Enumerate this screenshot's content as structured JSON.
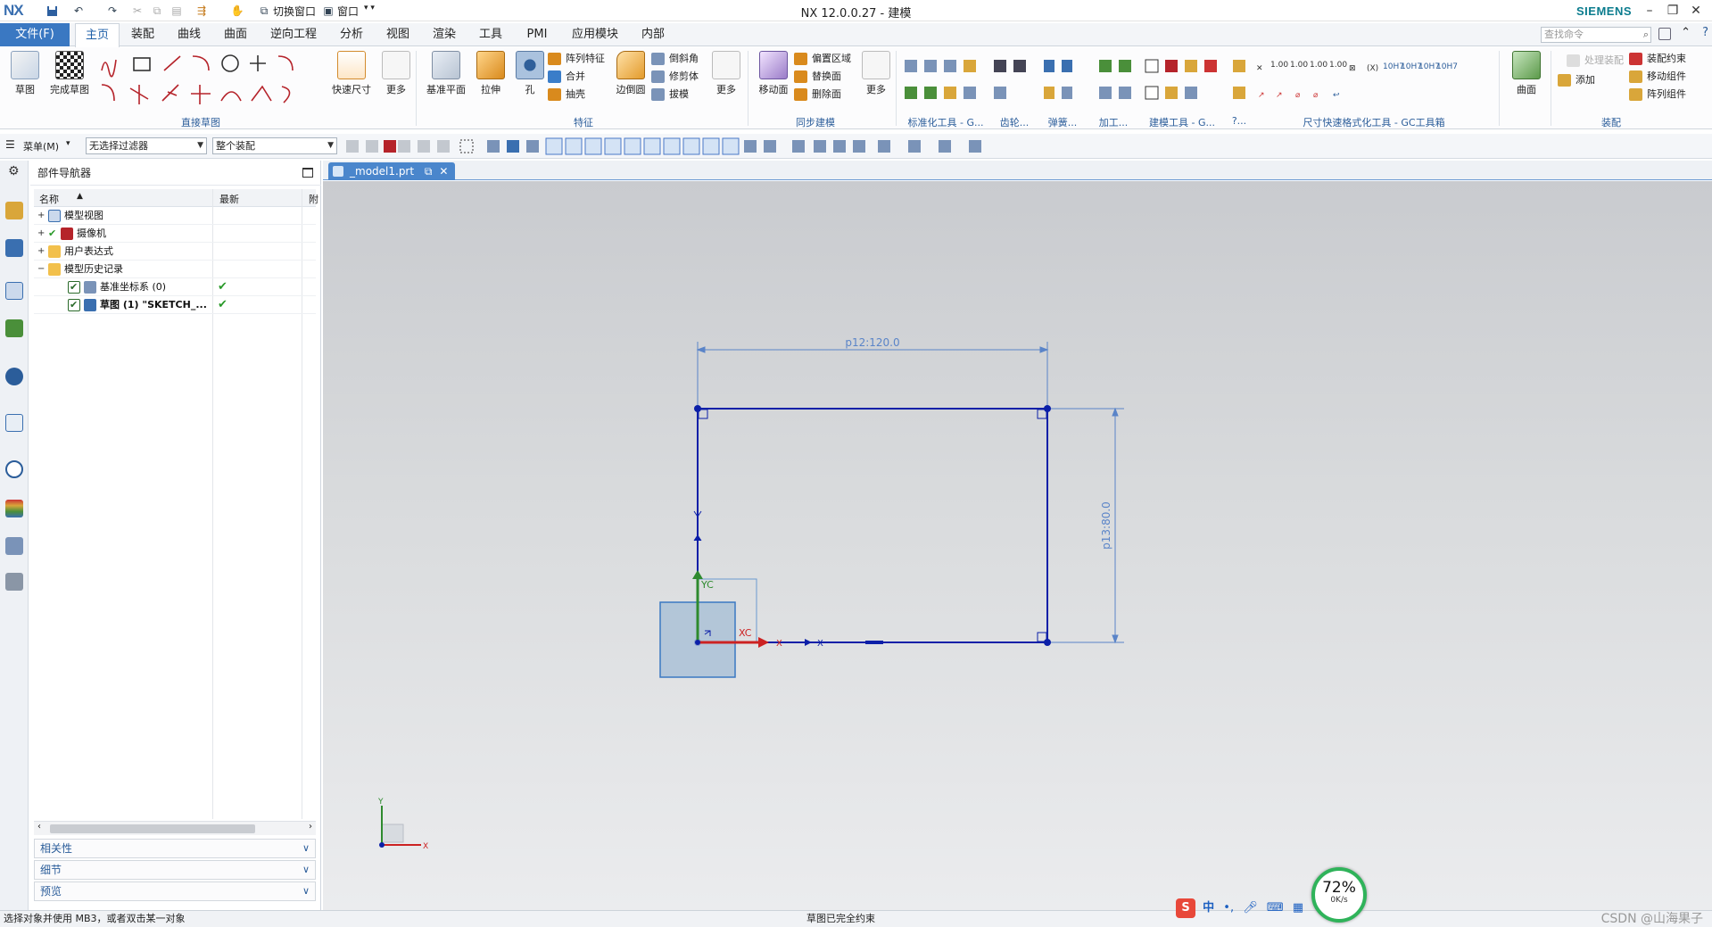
{
  "titlebar": {
    "logo": "NX",
    "title": "NX 12.0.0.27 - 建模",
    "brand": "SIEMENS",
    "switch_window": "切换窗口",
    "window_menu": "窗口"
  },
  "menu": {
    "file": "文件(F)",
    "tabs": [
      "主页",
      "装配",
      "曲线",
      "曲面",
      "逆向工程",
      "分析",
      "视图",
      "渲染",
      "工具",
      "PMI",
      "应用模块",
      "内部"
    ],
    "active_tab": "主页",
    "search_placeholder": "查找命令"
  },
  "ribbon": {
    "sketch": {
      "label": "草图",
      "finish": "完成草图",
      "group": "直接草图",
      "quick_dim": "快速尺寸",
      "more": "更多"
    },
    "feature": {
      "group": "特征",
      "datum_plane": "基准平面",
      "extrude": "拉伸",
      "hole": "孔",
      "pattern_feature": "阵列特征",
      "unite": "合并",
      "shell": "抽壳",
      "edge_blend": "边倒圆",
      "chamfer": "倒斜角",
      "trim_body": "修剪体",
      "draft": "拔模",
      "more": "更多"
    },
    "sync": {
      "group": "同步建模",
      "move_face": "移动面",
      "offset_region": "偏置区域",
      "replace_face": "替换面",
      "delete_face": "删除面",
      "more": "更多"
    },
    "group_standard": "标准化工具 - G...",
    "group_gear": "齿轮...",
    "group_spring": "弹簧...",
    "group_machining": "加工...",
    "group_modeling_tools": "建模工具 - G...",
    "group_misc": "?...",
    "group_dimension": "尺寸快速格式化工具 - GC工具箱",
    "surface": "曲面",
    "assembly": {
      "group": "装配",
      "add": "添加",
      "handle_assembly": "处理装配",
      "assembly_constraint": "装配约束",
      "move_component": "移动组件",
      "pattern_component": "阵列组件"
    }
  },
  "selection": {
    "menu": "菜单(M)",
    "filter": "无选择过滤器",
    "scope": "整个装配"
  },
  "navigator": {
    "title": "部件导航器",
    "col_name": "名称",
    "col_latest": "最新",
    "col_extra": "附",
    "rows": [
      {
        "label": "模型视图",
        "expander": "+",
        "latest": ""
      },
      {
        "label": "摄像机",
        "expander": "+",
        "latest": ""
      },
      {
        "label": "用户表达式",
        "expander": "+",
        "latest": ""
      },
      {
        "label": "模型历史记录",
        "expander": "−",
        "latest": ""
      },
      {
        "label": "基准坐标系 (0)",
        "expander": "",
        "latest": "✔"
      },
      {
        "label": "草图 (1) \"SKETCH_...",
        "expander": "",
        "latest": "✔"
      }
    ],
    "panels": [
      "相关性",
      "细节",
      "预览"
    ]
  },
  "document_tab": "_model1.prt",
  "sketch": {
    "dim_horizontal": "p12:120.0",
    "dim_vertical": "p13:80.0",
    "xc": "XC",
    "yc": "YC",
    "x": "X",
    "y": "Y"
  },
  "status": {
    "left": "选择对象并使用 MB3，或者双击某一对象",
    "middle": "草图已完全约束",
    "watermark": "CSDN @山海果子"
  },
  "overlay": {
    "ime_text": "中",
    "perf_percent": "72%",
    "perf_speed": "0K/s"
  },
  "colors": {
    "accent": "#3a78c2",
    "sketch_curve": "#0b1fa8",
    "dimension": "#4a78c8",
    "check": "#2a9a2a"
  }
}
